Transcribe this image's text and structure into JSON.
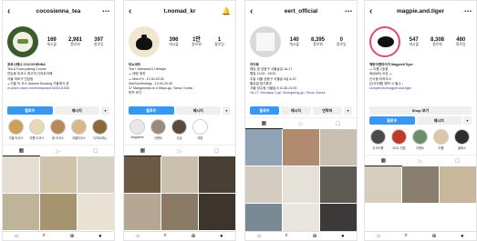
{
  "phones": [
    {
      "username": "cocosienna_tea",
      "stats": [
        {
          "value": "169",
          "label": "게시물"
        },
        {
          "value": "2,981",
          "label": "팔로워"
        },
        {
          "value": "397",
          "label": "팔로잉"
        }
      ],
      "bio": {
        "name": "코코시에나 COCOSIENNA",
        "lines": [
          "Tea & Food pairing Course",
          "연남동 티코스 최고의 디저트카페",
          "서울 마포구 연남동",
          "☕가을 티 코스 Autumn Booking 가을에서 본",
          "m.place.naver.com/restaurant/1628111558"
        ]
      },
      "buttons": {
        "follow": "팔로우",
        "message": "메시지",
        "more": "▾"
      },
      "highlights": [
        "가을 티코스",
        "여름 티코스",
        "봄 티코스",
        "겨울티코스",
        "디저트메뉴"
      ]
    },
    {
      "username": "t.nomad_kr",
      "stats": [
        {
          "value": "396",
          "label": "게시물"
        },
        {
          "value": "1만",
          "label": "팔로워"
        },
        {
          "value": "1",
          "label": "팔로잉"
        }
      ],
      "bio": {
        "name": "티노마드",
        "lines": [
          "Tea + Artisanal & Lifestyle",
          "☕ 매장 위치",
          "☕ Mon-Fri : 12:30-20:30",
          "Sat/Sun/Holiday : 12:00-20:30",
          "37 Mangwondo-ro 4 Mapo-gu, Seoul, Korea",
          "번역 보기"
        ]
      },
      "buttons": {
        "follow": "팔로우",
        "message": "메시지",
        "more": "▾"
      },
      "highlights": [
        "Magazine",
        "이벤트",
        "신상",
        "매장"
      ]
    },
    {
      "username": "eert_official",
      "stats": [
        {
          "value": "140",
          "label": "게시물"
        },
        {
          "value": "8,395",
          "label": "팔로워"
        },
        {
          "value": "0",
          "label": "팔로잉"
        }
      ],
      "bio": {
        "name": "이어트",
        "lines": [
          "웨딩 및 성동구 서울숲길 18-17",
          "평일 11:00 - 18:00",
          "주말 서울 성동구 서울숲 5길 6-20",
          "월요일 정기휴무",
          "서울 성수동 서울숲 8 11:30-21:00",
          "18-17, Seoulsup 2-gil, Seongdong-gu, Seoul, Korea"
        ]
      },
      "buttons": {
        "follow": "팔로우",
        "message": "메시지",
        "contact": "연락처",
        "more": "▾"
      },
      "highlights": []
    },
    {
      "username": "magpie.and.tiger",
      "stats": [
        {
          "value": "547",
          "label": "게시물"
        },
        {
          "value": "8,308",
          "label": "팔로워"
        },
        {
          "value": "460",
          "label": "팔로잉"
        }
      ],
      "bio": {
        "name": "맥파이앤타이거 Magpie&Tiger",
        "lines": [
          "☕ 티룸 2호점",
          "바(BAR) 오픈 ☕",
          "신사동 티하우스",
          "[신사티룸] 예약 시 필수 ↓",
          "compile.bio/magpie.and.tiger"
        ]
      },
      "buttons": {
        "follow": "팔로우",
        "message": "메시지",
        "more": "▾"
      },
      "shop_label": "Shop 보기",
      "highlights": [
        "신사티룸",
        "2021 연말",
        "이벤트",
        "티룸",
        "클래스"
      ]
    }
  ],
  "tab_icons": [
    "grid-icon",
    "reels-icon",
    "tagged-icon"
  ],
  "colors": {
    "follow": "#3897f0",
    "link": "#2a4a8a"
  }
}
